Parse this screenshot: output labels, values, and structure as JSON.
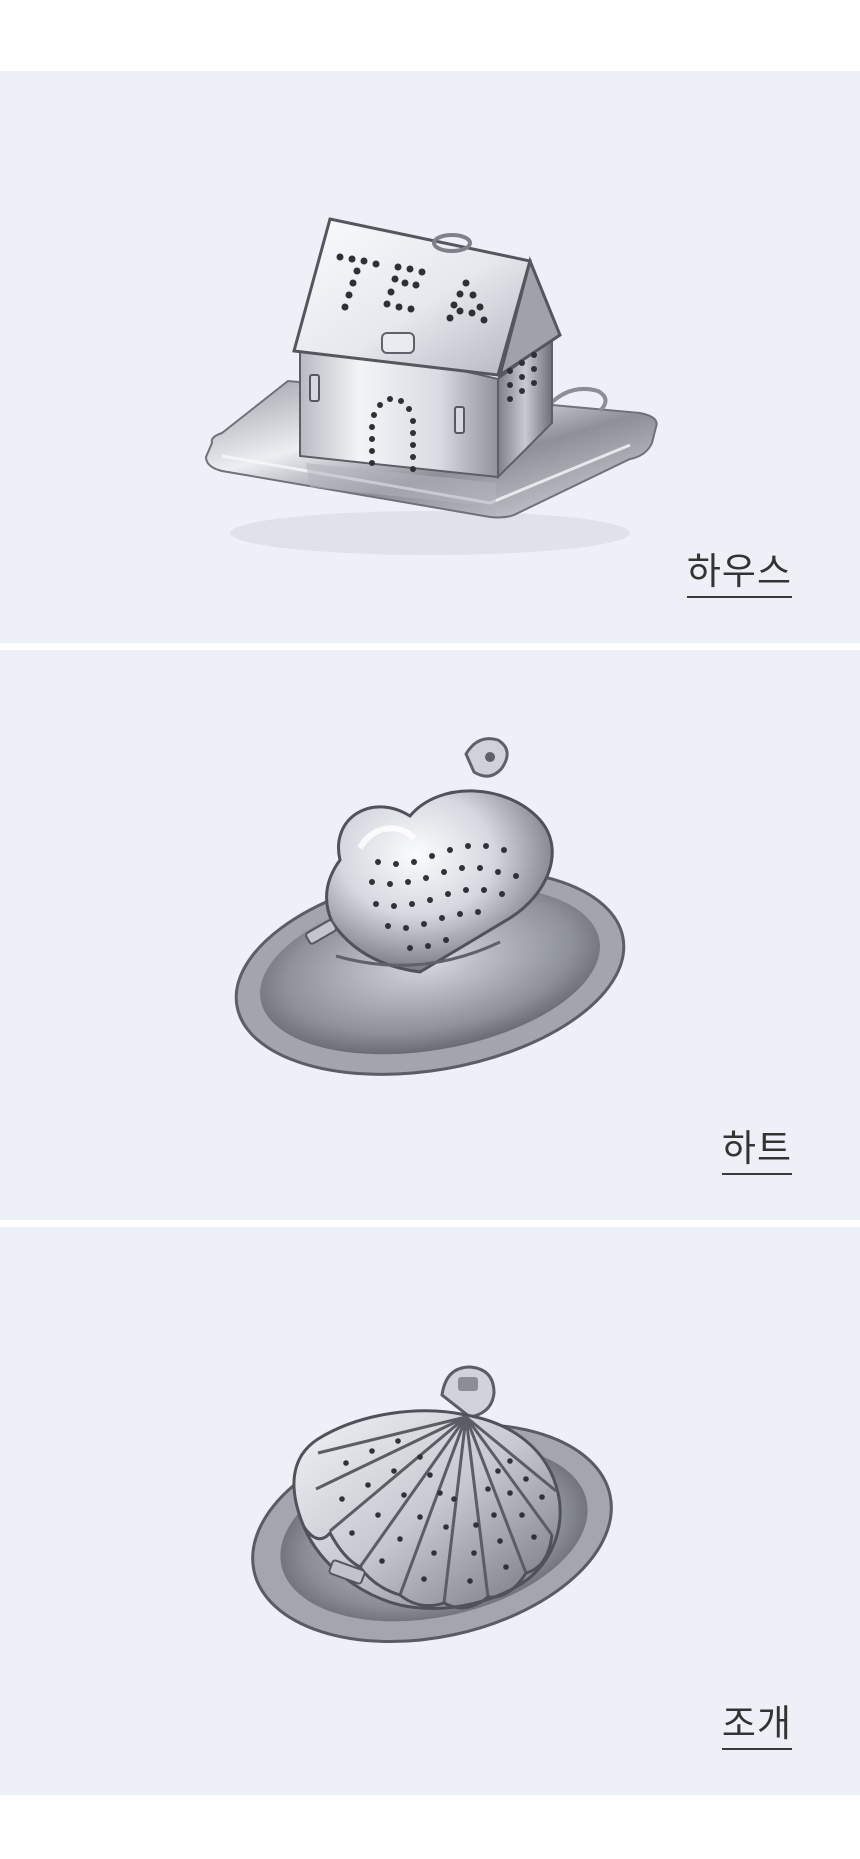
{
  "products": [
    {
      "id": "house",
      "caption": "하우스",
      "lettering": "TEA"
    },
    {
      "id": "heart",
      "caption": "하트"
    },
    {
      "id": "shell",
      "caption": "조개"
    }
  ],
  "colors": {
    "page_background": "#ffffff",
    "panel_background": "#eef0f8",
    "caption_text": "#333333",
    "metal_light": "#f4f5f8",
    "metal_mid": "#b9bcc4",
    "metal_dark": "#54575e"
  }
}
